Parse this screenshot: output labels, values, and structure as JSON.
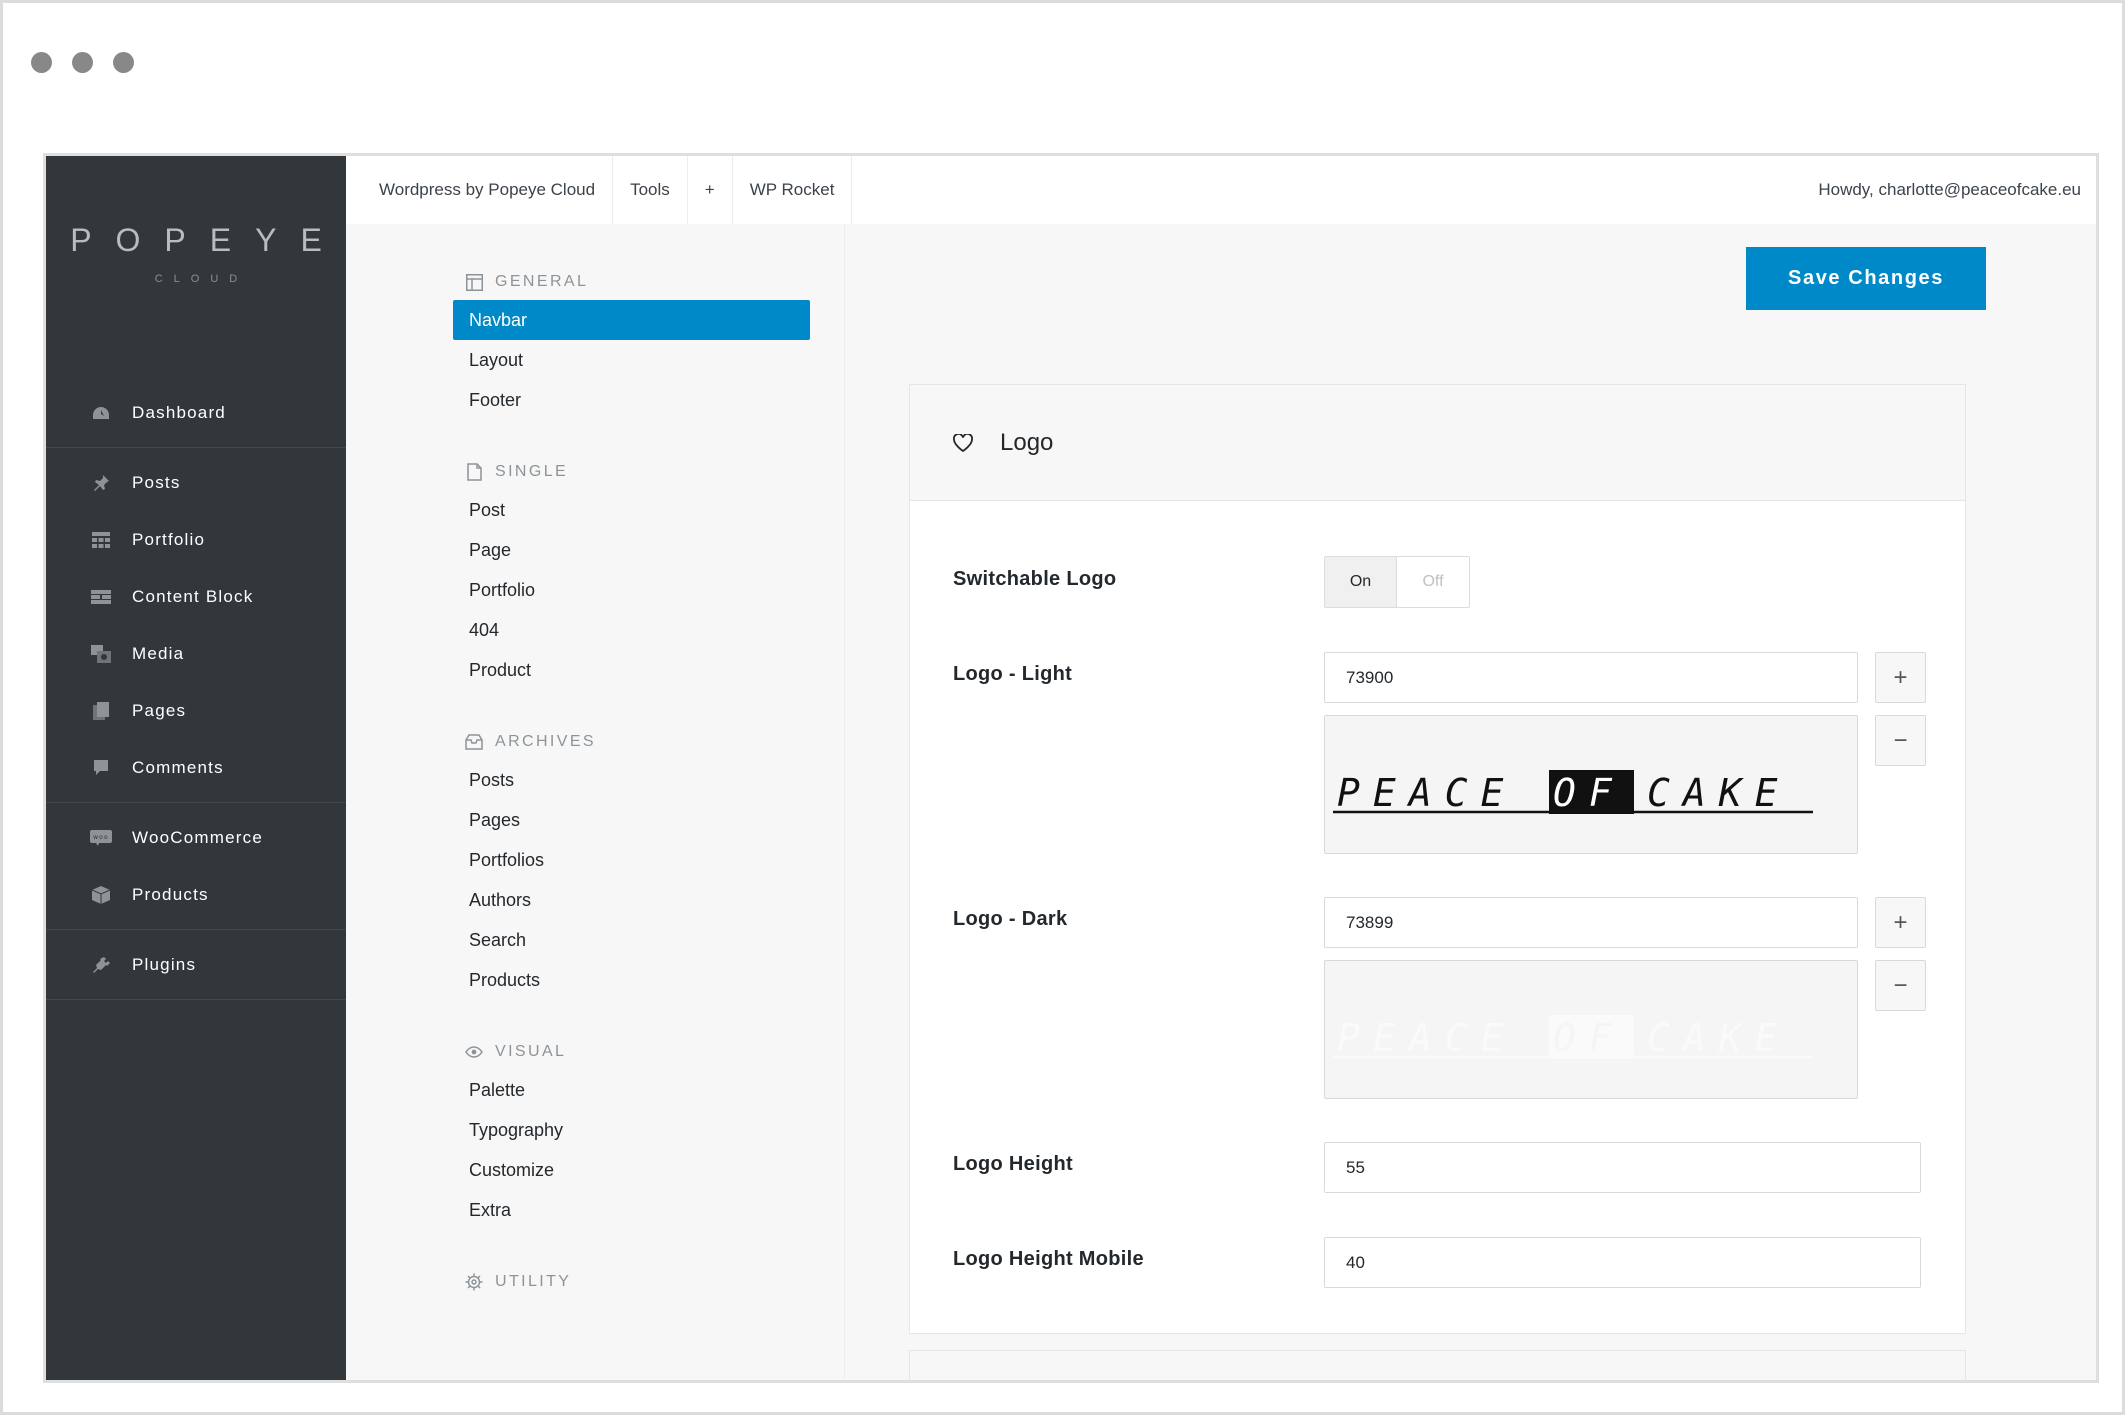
{
  "brand": {
    "name": "POPEYE",
    "sub": "CLOUD"
  },
  "sidebar": {
    "items": [
      {
        "label": "Dashboard",
        "icon": "dashboard-icon"
      },
      {
        "label": "Posts",
        "icon": "pin-icon"
      },
      {
        "label": "Portfolio",
        "icon": "grid-icon"
      },
      {
        "label": "Content Block",
        "icon": "block-icon"
      },
      {
        "label": "Media",
        "icon": "media-icon"
      },
      {
        "label": "Pages",
        "icon": "pages-icon"
      },
      {
        "label": "Comments",
        "icon": "comment-icon"
      },
      {
        "label": "WooCommerce",
        "icon": "woo-icon"
      },
      {
        "label": "Products",
        "icon": "box-icon"
      },
      {
        "label": "Plugins",
        "icon": "plug-icon"
      }
    ]
  },
  "topbar": {
    "site": "Wordpress by Popeye Cloud",
    "tools": "Tools",
    "plus": "+",
    "rocket": "WP Rocket",
    "howdy": "Howdy, charlotte@peaceofcake.eu"
  },
  "subnav": {
    "general": {
      "title": "GENERAL",
      "items": [
        "Navbar",
        "Layout",
        "Footer"
      ]
    },
    "single": {
      "title": "SINGLE",
      "items": [
        "Post",
        "Page",
        "Portfolio",
        "404",
        "Product"
      ]
    },
    "archives": {
      "title": "ARCHIVES",
      "items": [
        "Posts",
        "Pages",
        "Portfolios",
        "Authors",
        "Search",
        "Products"
      ]
    },
    "visual": {
      "title": "VISUAL",
      "items": [
        "Palette",
        "Typography",
        "Customize",
        "Extra"
      ]
    },
    "utility": {
      "title": "UTILITY"
    }
  },
  "actions": {
    "save": "Save Changes"
  },
  "logo_section": {
    "title": "Logo",
    "switchable_label": "Switchable Logo",
    "toggle_on": "On",
    "toggle_off": "Off",
    "light_label": "Logo - Light",
    "light_value": "73900",
    "dark_label": "Logo - Dark",
    "dark_value": "73899",
    "height_label": "Logo Height",
    "height_value": "55",
    "height_mobile_label": "Logo Height Mobile",
    "height_mobile_value": "40",
    "preview_text": {
      "peace": "PEACE",
      "of": "OF",
      "cake": "CAKE"
    }
  },
  "colors": {
    "accent": "#0089c8",
    "sidebar_bg": "#32373c"
  }
}
